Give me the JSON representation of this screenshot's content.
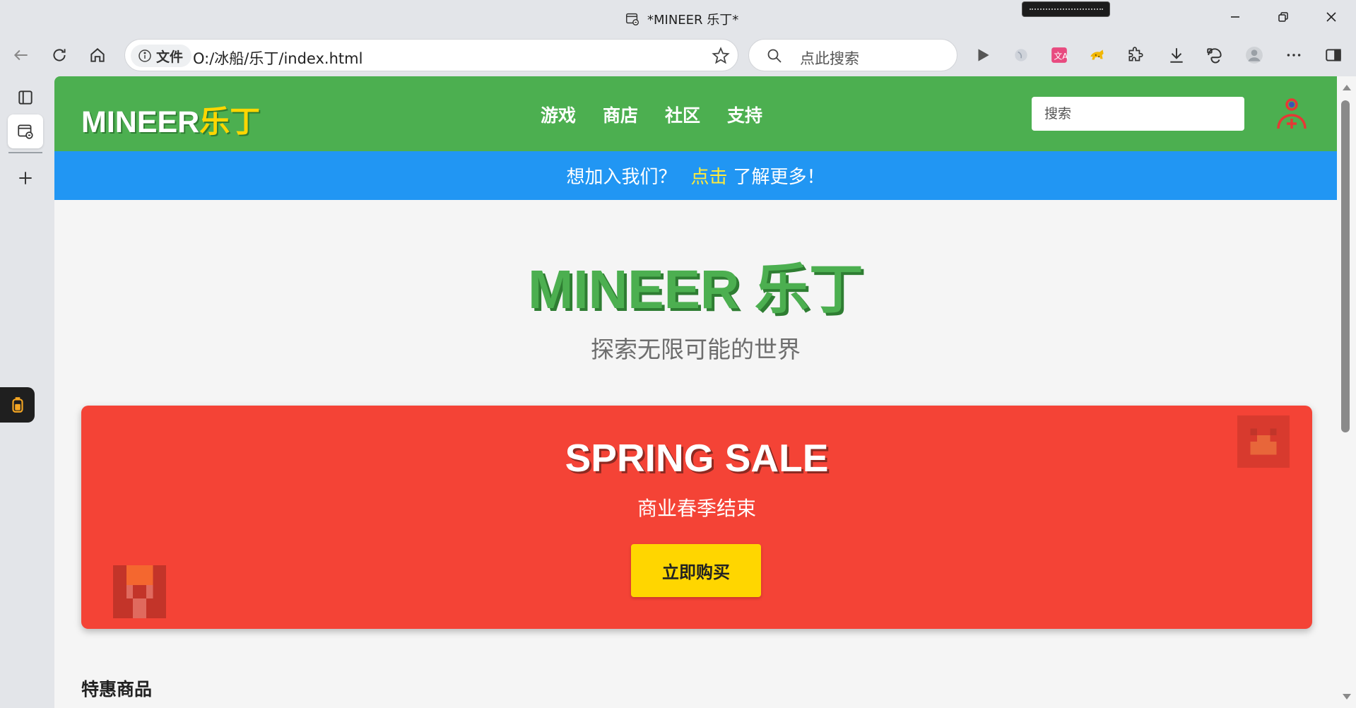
{
  "window": {
    "title": "*MINEER 乐丁*"
  },
  "browser": {
    "file_chip_label": "文件",
    "url": "O:/冰船/乐丁/index.html",
    "search_placeholder": "点此搜索"
  },
  "site": {
    "logo_main": "MINEER",
    "logo_accent": "乐丁",
    "nav": [
      {
        "label": "游戏"
      },
      {
        "label": "商店"
      },
      {
        "label": "社区"
      },
      {
        "label": "支持"
      }
    ],
    "search_placeholder": "搜索",
    "banner": {
      "prefix": "想加入我们？",
      "link": "点击",
      "suffix": "了解更多！"
    },
    "hero": {
      "title": "MINEER 乐丁",
      "subtitle": "探索无限可能的世界"
    },
    "sale": {
      "title": "SPRING SALE",
      "subtitle": "商业春季结束",
      "button": "立即购买"
    },
    "featured_title": "特惠商品"
  },
  "colors": {
    "header_green": "#4caf50",
    "banner_blue": "#2196f3",
    "sale_red": "#f44336",
    "accent_yellow": "#ffd600"
  }
}
